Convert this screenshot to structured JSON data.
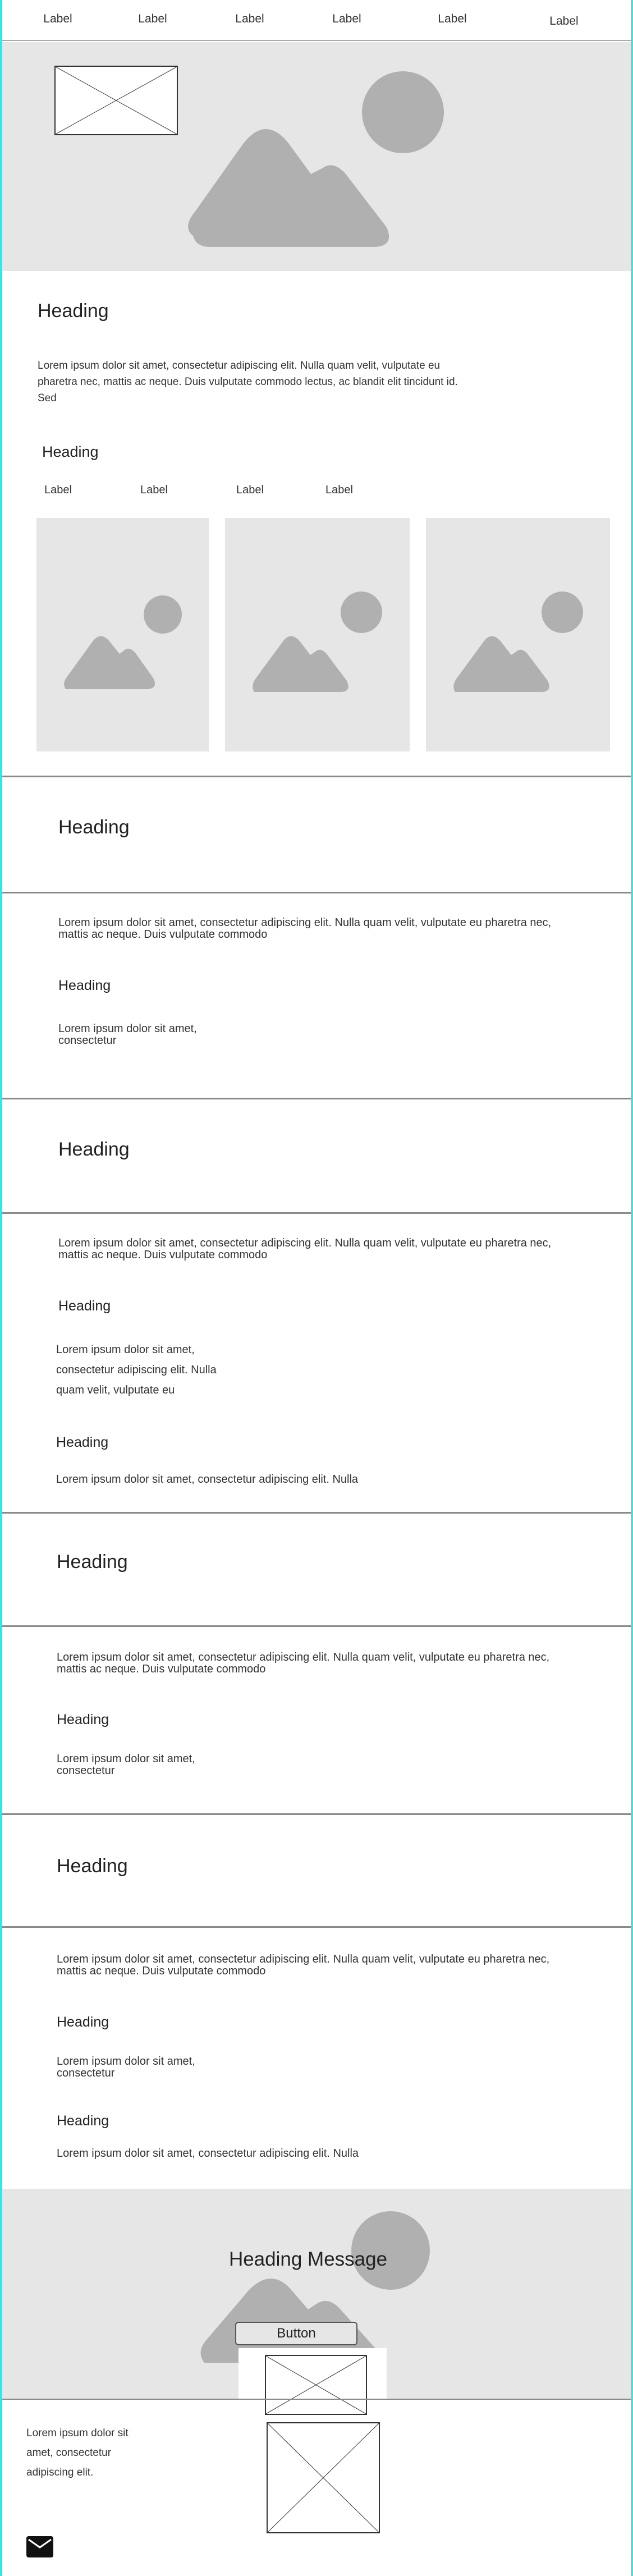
{
  "nav": {
    "labels": [
      "Label",
      "Label",
      "Label",
      "Label",
      "Label",
      "Label"
    ]
  },
  "intro": {
    "heading": "Heading",
    "text": "Lorem ipsum dolor sit amet, consectetur adipiscing elit. Nulla quam velit, vulputate eu pharetra nec, mattis ac neque. Duis vulputate commodo lectus, ac blandit elit tincidunt id. Sed",
    "subheading": "Heading",
    "labels": [
      "Label",
      "Label",
      "Label",
      "Label"
    ]
  },
  "sections": [
    {
      "heading": "Heading",
      "text": "Lorem ipsum dolor sit amet, consectetur adipiscing elit. Nulla quam velit, vulputate eu pharetra nec, mattis ac neque. Duis vulputate commodo",
      "subheading": "Heading",
      "subtext": "Lorem ipsum dolor sit amet, consectetur"
    },
    {
      "heading": "Heading",
      "text": "Lorem ipsum dolor sit amet, consectetur adipiscing elit. Nulla quam velit, vulputate eu pharetra nec, mattis ac neque. Duis vulputate commodo",
      "subheading": "Heading",
      "subtext": "Lorem ipsum dolor sit amet, consectetur adipiscing elit. Nulla quam velit, vulputate eu",
      "subheading2": "Heading",
      "subtext2": "Lorem ipsum dolor sit amet, consectetur adipiscing elit. Nulla"
    },
    {
      "heading": "Heading",
      "text": "Lorem ipsum dolor sit amet, consectetur adipiscing elit. Nulla quam velit, vulputate eu pharetra nec, mattis ac neque. Duis vulputate commodo",
      "subheading": "Heading",
      "subtext": "Lorem ipsum dolor sit amet, consectetur"
    },
    {
      "heading": "Heading",
      "text": "Lorem ipsum dolor sit amet, consectetur adipiscing elit. Nulla quam velit, vulputate eu pharetra nec, mattis ac neque. Duis vulputate commodo",
      "subheading": "Heading",
      "subtext": "Lorem ipsum dolor sit amet, consectetur",
      "subheading2": "Heading",
      "subtext2": "Lorem ipsum dolor sit amet, consectetur adipiscing elit. Nulla"
    }
  ],
  "cta": {
    "heading": "Heading Message",
    "button": "Button"
  },
  "footer": {
    "text": "Lorem ipsum dolor sit amet, consectetur adipiscing elit.",
    "icon": "mail-icon"
  }
}
